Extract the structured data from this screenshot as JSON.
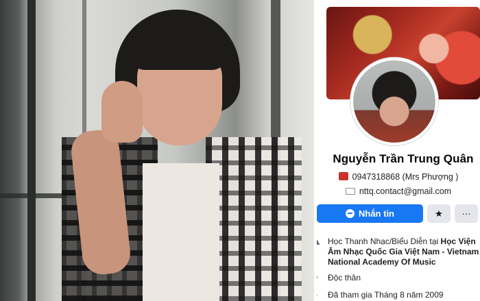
{
  "profile": {
    "name": "Nguyễn Trần Trung Quân",
    "phone": "0947318868 (Mrs Phượng )",
    "email": "nttq.contact@gmail.com",
    "message_button": "Nhắn tin",
    "star_icon": "★",
    "more_icon": "···",
    "education_prefix": "Học Thanh Nhạc/Biểu Diễn tại ",
    "education_school": "Học Viện Âm Nhạc Quốc Gia Việt Nam - Vietnam National Academy Of Music",
    "relationship": "Độc thân",
    "joined": "Đã tham gia Tháng 8 năm 2009"
  },
  "icons": {
    "phone": "phone-icon",
    "email": "email-icon",
    "messenger": "messenger-icon",
    "education": "graduation-cap-icon",
    "relationship": "heart-icon",
    "joined": "clock-icon"
  },
  "colors": {
    "accent": "#1877f2",
    "secondary_button": "#e4e6eb",
    "text": "#050505"
  }
}
